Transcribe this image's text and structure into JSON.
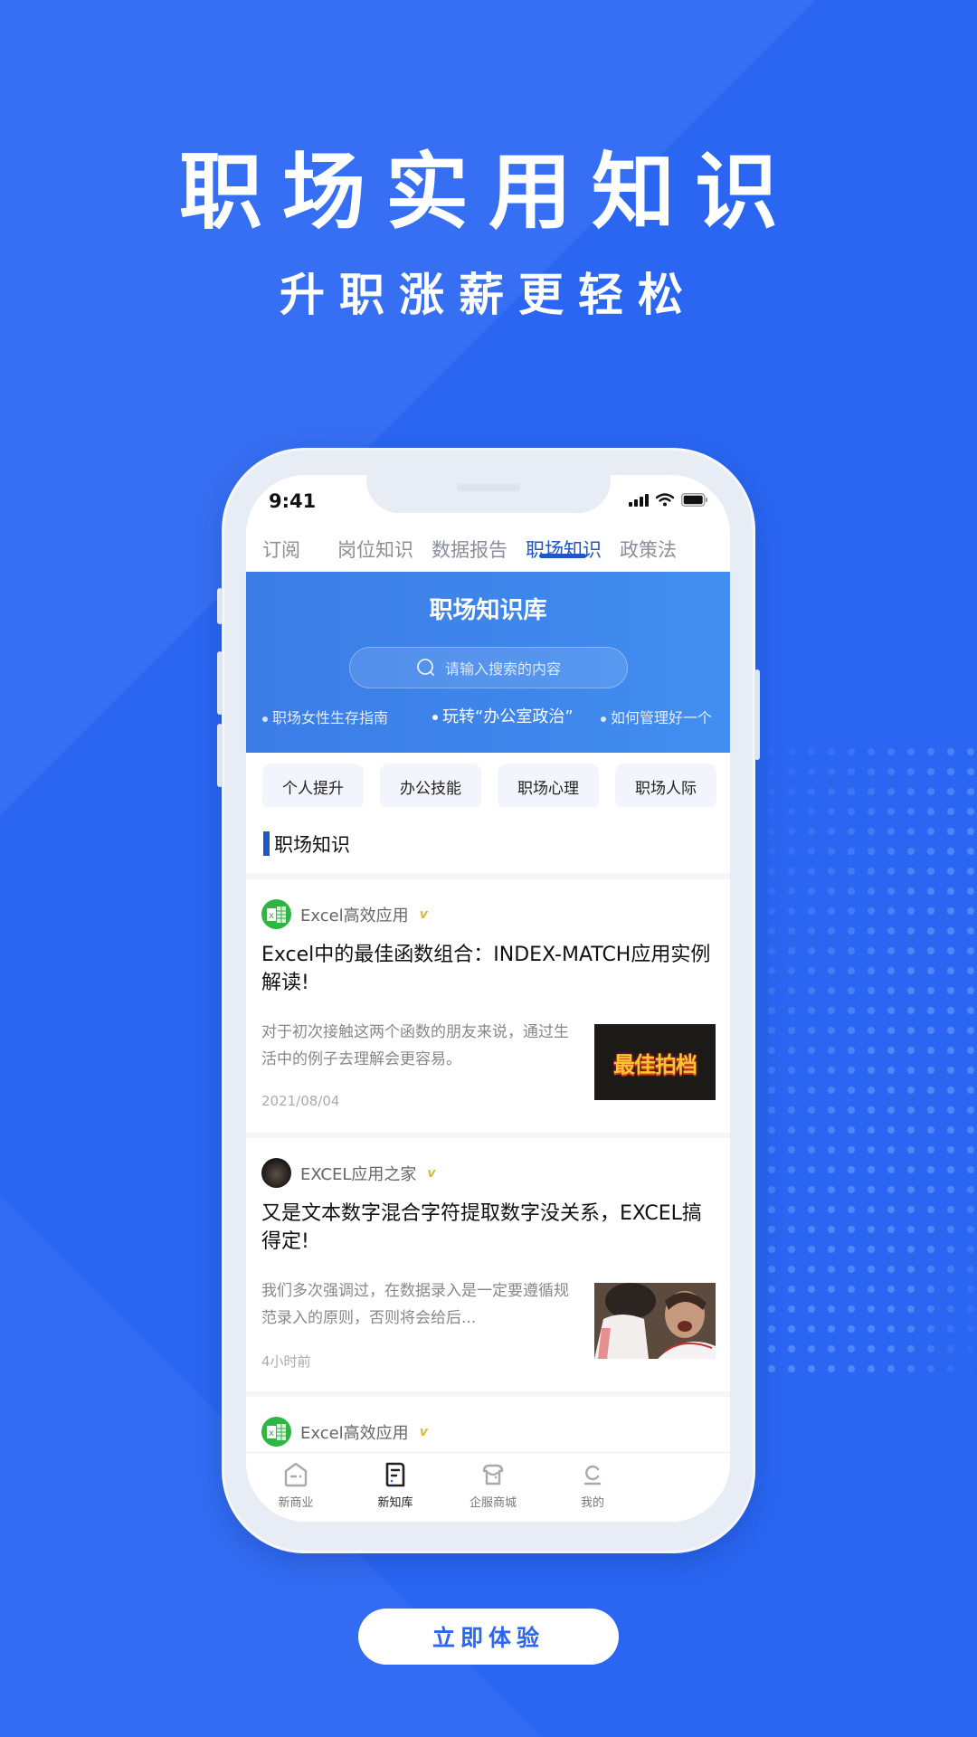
{
  "promo": {
    "headline": "职场实用知识",
    "subline": "升职涨薪更轻松",
    "cta_label": "立即体验"
  },
  "colors": {
    "background": "#2a66f2",
    "accent": "#1f57c3",
    "banner": "#3b7ce6",
    "verified": "#e2b53a",
    "excel_green": "#2fb543"
  },
  "status_bar": {
    "time": "9:41"
  },
  "tabs": [
    {
      "label": "订阅",
      "active": false
    },
    {
      "label": "岗位知识",
      "active": false
    },
    {
      "label": "数据报告",
      "active": false
    },
    {
      "label": "职场知识",
      "active": true
    },
    {
      "label": "政策法"
    }
  ],
  "banner": {
    "title": "职场知识库",
    "search_placeholder": "请输入搜索的内容",
    "hot_topics": [
      {
        "label": "职场女性生存指南",
        "active": false
      },
      {
        "label": "玩转“办公室政治”",
        "active": true
      },
      {
        "label": "如何管理好一个",
        "active": false
      }
    ]
  },
  "categories": [
    "个人提升",
    "办公技能",
    "职场心理",
    "职场人际"
  ],
  "section": {
    "title": "职场知识"
  },
  "articles": [
    {
      "author": "Excel高效应用",
      "author_icon": "excel-icon",
      "verified": "v",
      "title": "Excel中的最佳函数组合：INDEX-MATCH应用实例解读!",
      "summary": "对于初次接触这两个函数的朋友来说，通过生活中的例子去理解会更容易。",
      "date": "2021/08/04",
      "thumbnail_text": "最佳拍档"
    },
    {
      "author": "EXCEL应用之家",
      "author_icon": "avatar-photo",
      "verified": "v",
      "title": "又是文本数字混合字符提取数字没关系，EXCEL搞得定!",
      "summary": "我们多次强调过，在数据录入是一定要遵循规范录入的原则，否则将会给后...",
      "date": "4小时前",
      "thumbnail_text": ""
    },
    {
      "author": "Excel高效应用",
      "author_icon": "excel-icon",
      "verified": "v"
    }
  ],
  "bottom_nav": [
    {
      "label": "新商业",
      "icon": "business-icon",
      "active": false
    },
    {
      "label": "新知库",
      "icon": "knowledge-icon",
      "active": true
    },
    {
      "label": "企服商城",
      "icon": "store-icon",
      "active": false
    },
    {
      "label": "我的",
      "icon": "profile-icon",
      "active": false
    }
  ]
}
